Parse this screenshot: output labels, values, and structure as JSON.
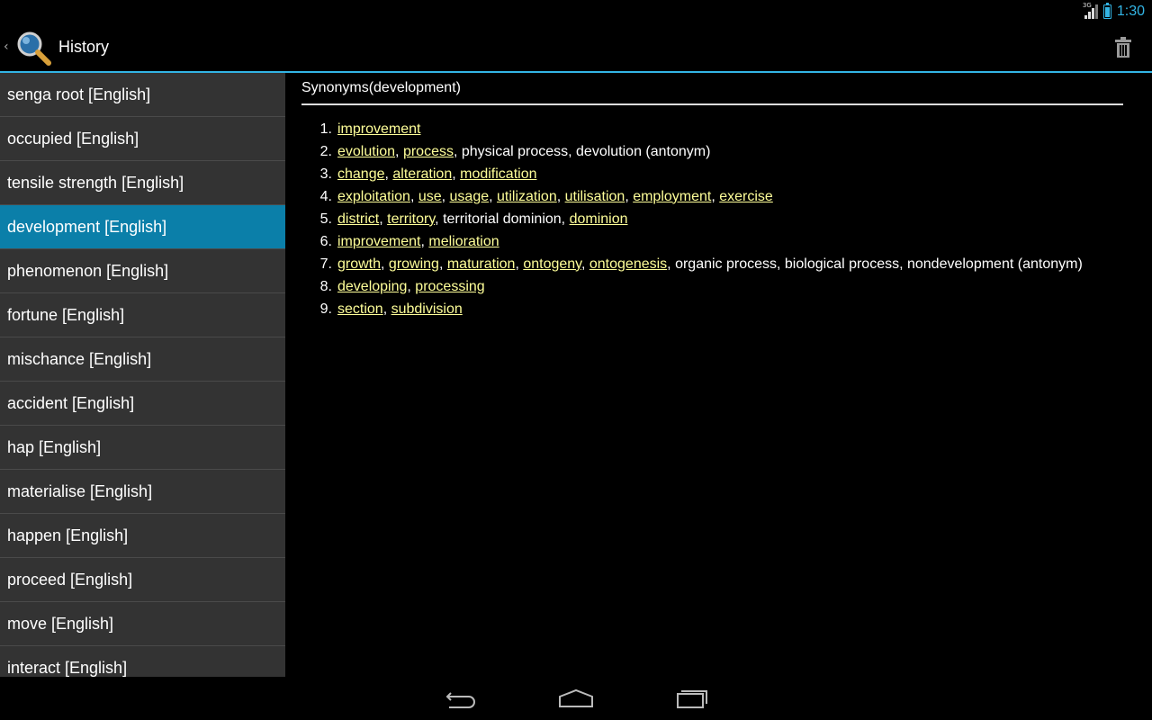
{
  "status": {
    "network_type": "3G",
    "time": "1:30"
  },
  "action_bar": {
    "title": "History",
    "app_icon": "magnifier-icon",
    "action_icon": "trash-icon"
  },
  "history": [
    {
      "label": "senga root [English]",
      "selected": false
    },
    {
      "label": "occupied [English]",
      "selected": false
    },
    {
      "label": "tensile strength [English]",
      "selected": false
    },
    {
      "label": "development [English]",
      "selected": true
    },
    {
      "label": "phenomenon [English]",
      "selected": false
    },
    {
      "label": "fortune [English]",
      "selected": false
    },
    {
      "label": "mischance [English]",
      "selected": false
    },
    {
      "label": "accident [English]",
      "selected": false
    },
    {
      "label": "hap [English]",
      "selected": false
    },
    {
      "label": "materialise [English]",
      "selected": false
    },
    {
      "label": "happen [English]",
      "selected": false
    },
    {
      "label": "proceed [English]",
      "selected": false
    },
    {
      "label": "move [English]",
      "selected": false
    },
    {
      "label": "interact [English]",
      "selected": false
    }
  ],
  "synonyms": {
    "title": "Synonyms(development)",
    "groups": [
      {
        "num": "1.",
        "words": [
          {
            "t": "improvement",
            "link": true
          }
        ]
      },
      {
        "num": "2.",
        "words": [
          {
            "t": "evolution",
            "link": true
          },
          {
            "t": "process",
            "link": true
          },
          {
            "t": "physical process",
            "link": false
          },
          {
            "t": "devolution (antonym)",
            "link": false
          }
        ]
      },
      {
        "num": "3.",
        "words": [
          {
            "t": "change",
            "link": true
          },
          {
            "t": "alteration",
            "link": true
          },
          {
            "t": "modification",
            "link": true
          }
        ]
      },
      {
        "num": "4.",
        "words": [
          {
            "t": "exploitation",
            "link": true
          },
          {
            "t": "use",
            "link": true
          },
          {
            "t": "usage",
            "link": true
          },
          {
            "t": "utilization",
            "link": true
          },
          {
            "t": "utilisation",
            "link": true
          },
          {
            "t": "employment",
            "link": true
          },
          {
            "t": "exercise",
            "link": true
          }
        ]
      },
      {
        "num": "5.",
        "words": [
          {
            "t": "district",
            "link": true
          },
          {
            "t": "territory",
            "link": true
          },
          {
            "t": "territorial dominion",
            "link": false
          },
          {
            "t": "dominion",
            "link": true
          }
        ]
      },
      {
        "num": "6.",
        "words": [
          {
            "t": "improvement",
            "link": true
          },
          {
            "t": "melioration",
            "link": true
          }
        ]
      },
      {
        "num": "7.",
        "words": [
          {
            "t": "growth",
            "link": true
          },
          {
            "t": "growing",
            "link": true
          },
          {
            "t": "maturation",
            "link": true
          },
          {
            "t": "ontogeny",
            "link": true
          },
          {
            "t": "ontogenesis",
            "link": true
          },
          {
            "t": "organic process",
            "link": false
          },
          {
            "t": "biological process",
            "link": false
          },
          {
            "t": "nondevelopment (antonym)",
            "link": false
          }
        ]
      },
      {
        "num": "8.",
        "words": [
          {
            "t": "developing",
            "link": true
          },
          {
            "t": "processing",
            "link": true
          }
        ]
      },
      {
        "num": "9.",
        "words": [
          {
            "t": "section",
            "link": true
          },
          {
            "t": "subdivision",
            "link": true
          }
        ]
      }
    ]
  },
  "navigation": {
    "buttons": [
      "back-icon",
      "home-icon",
      "recent-apps-icon"
    ]
  },
  "colors": {
    "accent": "#33b5e5",
    "selected_row": "#0b7fa9",
    "link": "#ffff99",
    "list_bg": "#333333"
  }
}
